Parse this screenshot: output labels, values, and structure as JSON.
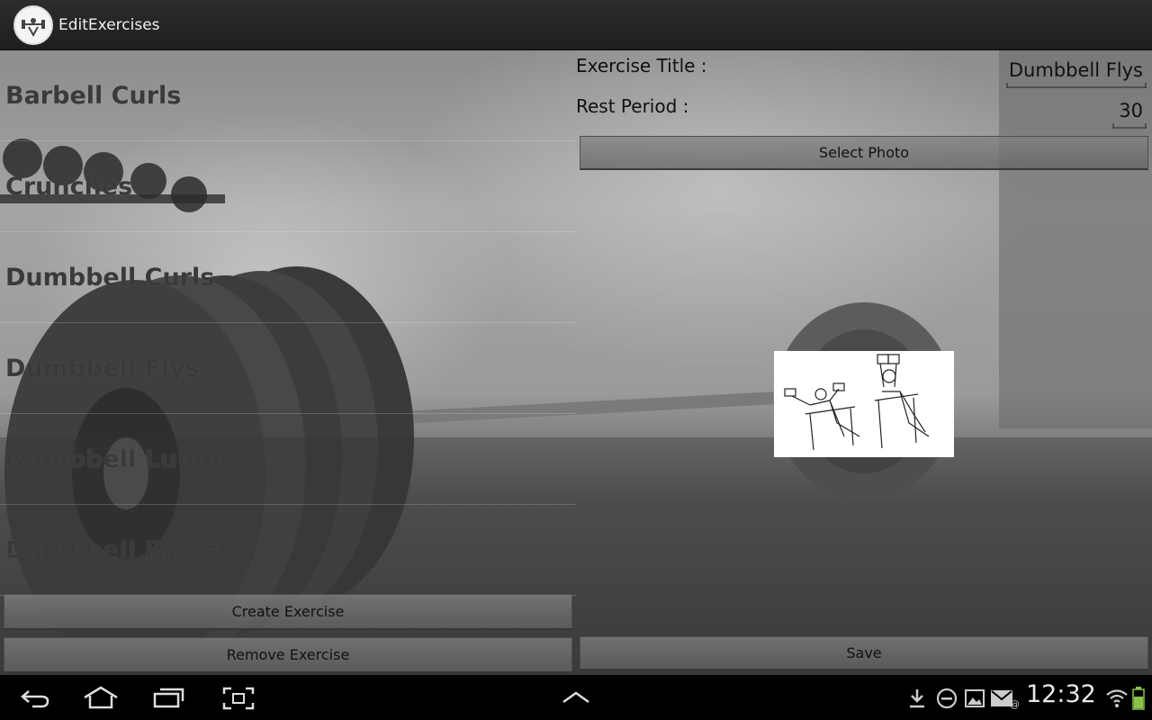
{
  "app": {
    "title": "EditExercises",
    "icon": "dumbbell-logo-icon"
  },
  "exercises": [
    {
      "label": "Barbell Curls"
    },
    {
      "label": "Crunches"
    },
    {
      "label": "Dumbbell Curls"
    },
    {
      "label": "Dumbbell Flys"
    },
    {
      "label": "Dumbbell Lunge"
    },
    {
      "label": "Dumbbell Press"
    }
  ],
  "buttons": {
    "create": "Create Exercise",
    "remove": "Remove Exercise",
    "select_photo": "Select Photo",
    "save": "Save"
  },
  "form": {
    "title_label": "Exercise Title :",
    "title_value": "Dumbbell Flys",
    "rest_label": "Rest Period :",
    "rest_value": "30"
  },
  "photo": {
    "icon": "dumbbell-flys-illustration"
  },
  "system_bar": {
    "time": "12:32",
    "nav_icons": [
      "back-icon",
      "home-icon",
      "recent-apps-icon",
      "screenshot-icon",
      "menu-up-icon"
    ],
    "status_icons": [
      "download-icon",
      "do-not-disturb-icon",
      "gallery-icon",
      "email-icon",
      "wifi-icon",
      "battery-icon"
    ],
    "battery_color": "#8bc34a"
  }
}
